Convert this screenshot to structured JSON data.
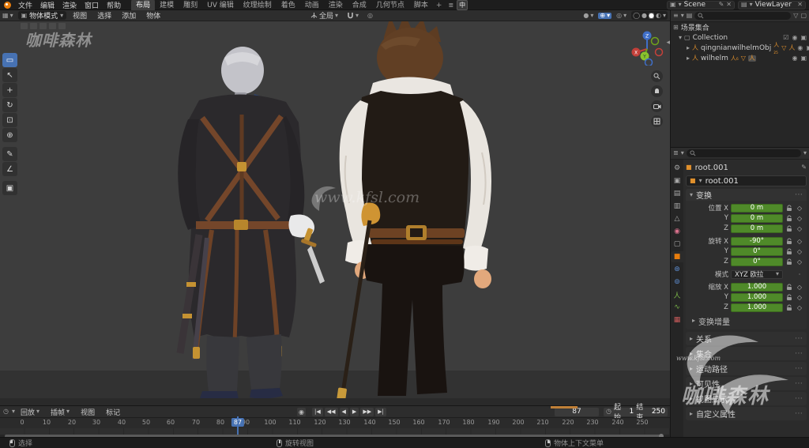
{
  "topbar": {
    "menus": [
      "文件",
      "编辑",
      "渲染",
      "窗口",
      "帮助"
    ],
    "tabs": [
      "布局",
      "建模",
      "雕刻",
      "UV 编辑",
      "纹理绘制",
      "着色",
      "动画",
      "渲染",
      "合成",
      "几何节点",
      "脚本"
    ],
    "add_tab": "+",
    "ime": "中",
    "scene_label": "Scene",
    "viewlayer_label": "ViewLayer"
  },
  "viewport_header": {
    "mode": "物体模式",
    "menus": [
      "视图",
      "选择",
      "添加",
      "物体"
    ],
    "orientation": "全局"
  },
  "outliner": {
    "scene_collection": "场景集合",
    "collection": "Collection",
    "objects": [
      {
        "name": "qingnianwilhelmObj",
        "badge": "人₂₅"
      },
      {
        "name": "wilhelm",
        "badge": "人₆"
      }
    ]
  },
  "properties": {
    "breadcrumb": "root.001",
    "datablock": "root.001",
    "transform": {
      "title": "变换",
      "loc": {
        "x": {
          "label": "位置 X",
          "value": "0 m"
        },
        "y": {
          "label": "Y",
          "value": "0 m"
        },
        "z": {
          "label": "Z",
          "value": "0 m"
        }
      },
      "rot": {
        "x": {
          "label": "旋转 X",
          "value": "-90°"
        },
        "y": {
          "label": "Y",
          "value": "0°"
        },
        "z": {
          "label": "Z",
          "value": "0°"
        }
      },
      "mode": {
        "label": "模式",
        "value": "XYZ 欧拉"
      },
      "scale": {
        "x": {
          "label": "缩放 X",
          "value": "1.000"
        },
        "y": {
          "label": "Y",
          "value": "1.000"
        },
        "z": {
          "label": "Z",
          "value": "1.000"
        }
      },
      "delta": "变换增量"
    },
    "sections": [
      "关系",
      "集合",
      "运动路径",
      "可见性",
      "视图显示",
      "自定义属性"
    ]
  },
  "timeline": {
    "menus": [
      "回放",
      "插帧",
      "视图",
      "标记"
    ],
    "playback_icons": [
      "|◀",
      "◀◀",
      "◀",
      "▶",
      "▶▶",
      "▶|"
    ],
    "current_frame": "87",
    "start_label": "起始",
    "start_value": "1",
    "end_label": "结束",
    "end_value": "250",
    "ticks": [
      "0",
      "10",
      "20",
      "30",
      "40",
      "50",
      "60",
      "70",
      "80",
      "90",
      "100",
      "110",
      "120",
      "130",
      "140",
      "150",
      "160",
      "170",
      "180",
      "190",
      "200",
      "210",
      "220",
      "230",
      "240",
      "250"
    ]
  },
  "statusbar": {
    "hints": [
      "选择",
      "旋转视图",
      "物体上下文菜单"
    ]
  },
  "watermark": {
    "brand": "咖啡森林",
    "site": "www.kfsl.com"
  },
  "icons": {
    "dropdown": "▾",
    "expand": "▸",
    "collapse": "▾",
    "close": "✕",
    "select": "▭",
    "cursor": "↖",
    "move": "+",
    "rotate": "↻",
    "scale": "⊡",
    "transform": "⊕",
    "annotate": "✎",
    "measure": "∠",
    "cube": "▣",
    "eye": "◉",
    "camera_restrict": "▣",
    "checkbox": "☑",
    "armature": "人",
    "triangle_down": "▽",
    "collection": "▢",
    "grid": "⊞",
    "funnel": "▽",
    "dots": "⋯",
    "diamond": "◇",
    "prop_tool": "⚙",
    "prop_render": "▣",
    "prop_output": "▤",
    "prop_viewlayer": "▥",
    "prop_scene": "△",
    "prop_world": "◉",
    "prop_collection": "▢",
    "prop_object": "■",
    "prop_modifier": "⊛",
    "prop_physics": "⊚",
    "prop_data": "人",
    "prop_bone": "∿",
    "prop_texture": "▦",
    "clock": "◷",
    "record": "◉",
    "proportional": "◎",
    "overlay": "◎",
    "wireframe": "◯",
    "solid": "●",
    "material": "●",
    "rendered": "◐",
    "pin": "✎",
    "editor_outliner": "≡",
    "editor_props": "≣",
    "editor_3d": "▦",
    "scene_db": "▣",
    "viewlayer_db": "▤",
    "npanel": "◂"
  },
  "colors": {
    "accent": "#4772b3",
    "object_orange": "#e87d0d",
    "field_green": "#4f8a29"
  }
}
